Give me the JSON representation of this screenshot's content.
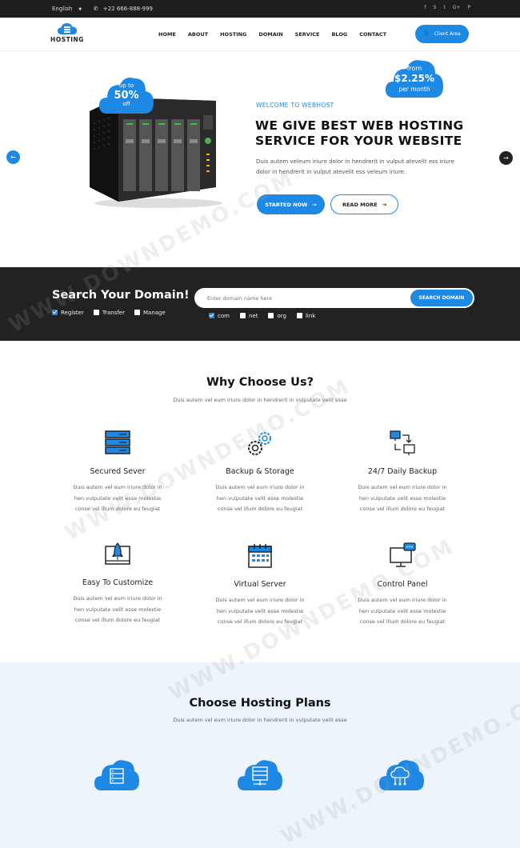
{
  "topbar": {
    "language": "English",
    "phone": "+22 666-888-999",
    "social_icons": [
      "facebook-icon",
      "skype-icon",
      "twitter-icon",
      "google-plus-icon",
      "pinterest-icon"
    ]
  },
  "header": {
    "logo_text": "HOSTING",
    "nav": [
      "HOME",
      "ABOUT",
      "HOSTING",
      "DOMAIN",
      "SERVICE",
      "BLOG",
      "CONTACT"
    ],
    "client_button": "Client Area"
  },
  "hero": {
    "badge_left": {
      "line1": "up to",
      "line2": "50%",
      "line3": "off"
    },
    "badge_right": {
      "line1": "from",
      "line2": "$2.25%",
      "line3": "per month"
    },
    "welcome": "WELCOME TO WEBHOST",
    "title_line1": "WE GIVE BEST WEB HOSTING",
    "title_line2": "SERVICE FOR YOUR WEBSITE",
    "text": "Duis autem veleum iriure dolor in hendrerit in vulput atevelit ess iriure dolor in hendrerit in vulput atevelit ess veleum iriure.",
    "btn_start": "STARTED NOW",
    "btn_read": "READ MORE"
  },
  "search": {
    "title": "Search Your Domain!",
    "options": [
      {
        "label": "Register",
        "checked": true
      },
      {
        "label": "Transfer",
        "checked": false
      },
      {
        "label": "Manage",
        "checked": false
      }
    ],
    "placeholder": "Enter domain name here",
    "button": "SEARCH DOMAIN",
    "tlds": [
      {
        "label": "com",
        "checked": true
      },
      {
        "label": "net",
        "checked": false
      },
      {
        "label": "org",
        "checked": false
      },
      {
        "label": "link",
        "checked": false
      }
    ]
  },
  "why": {
    "title": "Why Choose Us?",
    "subtitle": "Duis autem vel eum iriure dolor in hendrerit in vulputate velit esse",
    "features": [
      {
        "title": "Secured Sever",
        "icon": "server-rack-icon",
        "desc1": "Duis autem vel eum iriure dolor in",
        "desc2": "hen vulputate velit esse molestie",
        "desc3": "conse vel illum dolore eu feugiat"
      },
      {
        "title": "Backup & Storage",
        "icon": "gears-icon",
        "desc1": "Duis autem vel eum iriure dolor in",
        "desc2": "hen vulputate velit esse molestie",
        "desc3": "conse vel illum dolore eu feugiat"
      },
      {
        "title": "24/7 Daily Backup",
        "icon": "network-sync-icon",
        "desc1": "Duis autem vel eum iriure dolor in",
        "desc2": "hen vulputate velit esse molestie",
        "desc3": "conse vel illum dolore eu feugiat"
      },
      {
        "title": "Easy To Customize",
        "icon": "rocket-launch-icon",
        "desc1": "Duis autem vel eum iriure dolor in",
        "desc2": "hen vulputate velit esse molestie",
        "desc3": "conse vel illum dolore eu feugiat"
      },
      {
        "title": "Virtual Server",
        "icon": "calendar-grid-icon",
        "desc1": "Duis autem vel eum iriure dolor in",
        "desc2": "hen vulputate velit esse molestie",
        "desc3": "conse vel illum dolore eu feugiat"
      },
      {
        "title": "Control Panel",
        "icon": "monitor-chat-icon",
        "desc1": "Duis autem vel eum iriure dolor in",
        "desc2": "hen vulputate velit esse molestie",
        "desc3": "conse vel illum dolore eu feugiat"
      }
    ]
  },
  "plans": {
    "title": "Choose Hosting Plans",
    "subtitle": "Duis autem vel eum iriure dolor in hendrerit in vulputate velit esse"
  },
  "colors": {
    "accent": "#1e88e5",
    "dark": "#222222",
    "light_bg": "#eef4fb"
  },
  "watermark": "WWW.DOWNDEMO.COM"
}
